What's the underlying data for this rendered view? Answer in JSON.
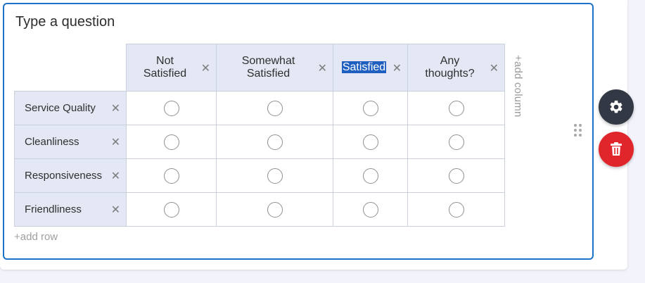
{
  "question": {
    "title": "Type a question",
    "columns": [
      {
        "label_line1": "Not",
        "label_line2": "Satisfied"
      },
      {
        "label_line1": "Somewhat",
        "label_line2": "Satisfied"
      },
      {
        "label_line1": "Satisfied",
        "label_line2": ""
      },
      {
        "label_line1": "Any",
        "label_line2": "thoughts?"
      }
    ],
    "rows": [
      {
        "label": "Service Quality"
      },
      {
        "label": "Cleanliness"
      },
      {
        "label": "Responsiveness"
      },
      {
        "label": "Friendliness"
      }
    ],
    "remove_symbol": "✕",
    "add_column_label": "+add column",
    "add_row_label": "+add row"
  },
  "actions": {
    "settings_icon": "gear-icon",
    "delete_icon": "trash-icon"
  },
  "colors": {
    "accent": "#1a73c8",
    "header_bg": "#e3e8f4",
    "settings_bg": "#333845",
    "delete_bg": "#e0252b",
    "selection_bg": "#1f5fbf"
  }
}
